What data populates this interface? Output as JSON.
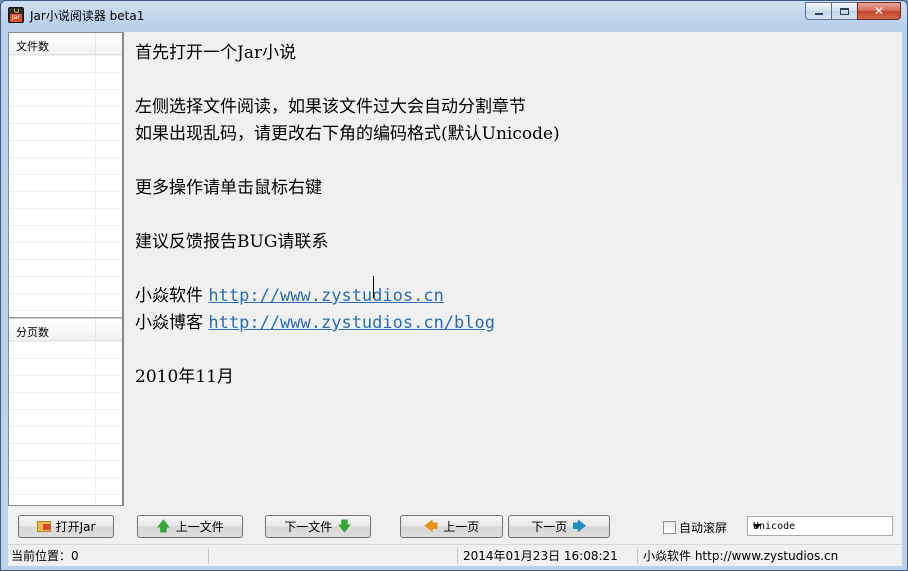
{
  "window": {
    "title": "Jar小说阅读器 beta1",
    "controls": {
      "minimize": "minimize",
      "maximize": "maximize",
      "close": "✕"
    }
  },
  "sidebar": {
    "files_header": "文件数",
    "pages_header": "分页数"
  },
  "reader": {
    "lines": [
      "首先打开一个Jar小说",
      "左侧选择文件阅读，如果该文件过大会自动分割章节",
      "如果出现乱码，请更改右下角的编码格式(默认Unicode)",
      "更多操作请单击鼠标右键",
      "建议反馈报告BUG请联系",
      "小焱软件",
      "小焱博客",
      "2010年11月"
    ],
    "links": {
      "software": "http://www.zystudios.cn",
      "blog": "http://www.zystudios.cn/blog"
    }
  },
  "toolbar": {
    "open_label": "打开Jar",
    "prev_file_label": "上一文件",
    "next_file_label": "下一文件",
    "prev_page_label": "上一页",
    "next_page_label": "下一页",
    "autoscroll_label": "自动滚屏",
    "autoscroll_checked": false,
    "encoding_value": "Unicode"
  },
  "status": {
    "position": "当前位置：0",
    "datetime": "2014年01月23日 16:08:21",
    "credit": "小焱软件 http://www.zystudios.cn"
  },
  "icons": {
    "app": "jar-app-icon",
    "open": "folder-icon",
    "prev_file": "arrow-up-icon",
    "next_file": "arrow-down-icon",
    "prev_page": "arrow-left-icon",
    "next_page": "arrow-right-icon"
  }
}
